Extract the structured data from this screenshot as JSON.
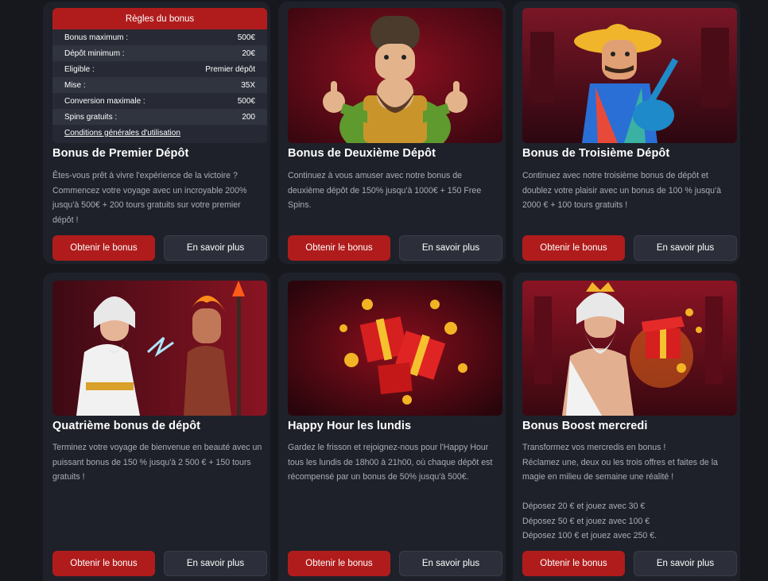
{
  "colors": {
    "accent": "#b01c1c",
    "background": "#16181e",
    "card": "#1e2129",
    "muted_text": "#a9adb8"
  },
  "rules": {
    "title": "Règles du bonus",
    "rows": [
      {
        "label": "Bonus maximum :",
        "value": "500€"
      },
      {
        "label": "Dépôt minimum :",
        "value": "20€"
      },
      {
        "label": "Eligible :",
        "value": "Premier dépôt"
      },
      {
        "label": "Mise :",
        "value": "35X"
      },
      {
        "label": "Conversion maximale :",
        "value": "500€"
      },
      {
        "label": "Spins gratuits :",
        "value": "200"
      }
    ],
    "link": "Conditions générales d'utilisation"
  },
  "buttons": {
    "primary": "Obtenir le bonus",
    "secondary": "En savoir plus"
  },
  "cards": [
    {
      "title": "Bonus de Premier Dépôt",
      "desc": [
        "Êtes-vous prêt à vivre l'expérience de la victoire ? Commencez votre voyage avec un incroyable 200% jusqu'à 500€ + 200 tours gratuits sur votre premier dépôt !"
      ],
      "image": "rules-table"
    },
    {
      "title": "Bonus de Deuxième Dépôt",
      "desc": [
        "Continuez à vous amuser avec notre bonus de deuxième dépôt de 150% jusqu'à 1000€ + 150 Free Spins."
      ],
      "image": "bearded-miner-thumbs-up-illustration"
    },
    {
      "title": "Bonus de Troisième Dépôt",
      "desc": [
        "Continuez avec notre troisième bonus de dépôt et doublez votre plaisir avec un bonus de 100 % jusqu'à 2000 € + 100 tours gratuits !"
      ],
      "image": "mariachi-guitar-player-illustration"
    },
    {
      "title": "Quatrième bonus de dépôt",
      "desc": [
        "Terminez votre voyage de bienvenue en beauté avec un puissant bonus de 150 % jusqu'à 2 500 € + 150 tours gratuits !"
      ],
      "image": "zeus-and-hades-illustration"
    },
    {
      "title": "Happy Hour les lundis",
      "desc": [
        "Gardez le frisson et rejoignez-nous pour l'Happy Hour tous les lundis de 18h00 à 21h00, où chaque dépôt est récompensé par un bonus de 50% jusqu'à 500€."
      ],
      "image": "gift-boxes-and-coins-illustration"
    },
    {
      "title": "Bonus Boost mercredi",
      "desc": [
        "Transformez vos mercredis en bonus !",
        "Réclamez une, deux ou les trois offres et faites de la magie en milieu de semaine une réalité !",
        "",
        "Déposez 20 € et jouez avec 30 €",
        "Déposez 50 € et jouez avec 100 €",
        "Déposez 100 € et jouez avec 250 €."
      ],
      "image": "zeus-with-gift-box-illustration"
    }
  ]
}
